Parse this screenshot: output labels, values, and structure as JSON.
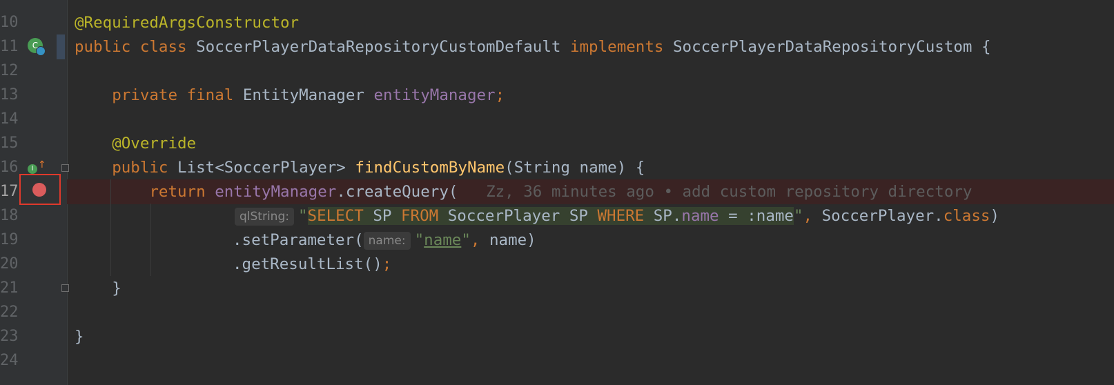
{
  "editor": {
    "lines": [
      {
        "num": "10"
      },
      {
        "num": "11"
      },
      {
        "num": "12"
      },
      {
        "num": "13"
      },
      {
        "num": "14"
      },
      {
        "num": "15"
      },
      {
        "num": "16"
      },
      {
        "num": "17"
      },
      {
        "num": "18"
      },
      {
        "num": "19"
      },
      {
        "num": "20"
      },
      {
        "num": "21"
      },
      {
        "num": "22"
      },
      {
        "num": "23"
      },
      {
        "num": "24"
      }
    ],
    "tokens": {
      "l10_ann": "@RequiredArgsConstructor",
      "l11_public": "public",
      "l11_class": "class",
      "l11_name": "SoccerPlayerDataRepositoryCustomDefault",
      "l11_implements": "implements",
      "l11_iface": "SoccerPlayerDataRepositoryCustom {",
      "l13_private": "private",
      "l13_final": "final",
      "l13_type": "EntityManager",
      "l13_field": "entityManager",
      "l13_semi": ";",
      "l15_ann": "@Override",
      "l16_public": "public",
      "l16_type": "List<SoccerPlayer>",
      "l16_method": "findCustomByName",
      "l16_params": "(String name) {",
      "l17_return": "return",
      "l17_field": "entityManager",
      "l17_call": ".createQuery(",
      "l17_blame": "Zz, 36 minutes ago • add custom repository directory",
      "l18_hint": "qlString:",
      "l18_quote_open": "\"",
      "l18_select": "SELECT",
      "l18_sp1": "SP",
      "l18_from": "FROM",
      "l18_entity": "SoccerPlayer SP",
      "l18_where": "WHERE",
      "l18_spdot": "SP.",
      "l18_namefield": "name",
      "l18_eq": "= :name",
      "l18_quote_close": "\"",
      "l18_comma": ",",
      "l18_classref": "SoccerPlayer.",
      "l18_classkw": "class",
      "l18_close": ")",
      "l19_call": ".setParameter(",
      "l19_hint": "name:",
      "l19_q1": "\"",
      "l19_str": "name",
      "l19_q2": "\"",
      "l19_rest_comma": ",",
      "l19_rest": "name)",
      "l20_call": ".getResultList()",
      "l20_semi": ";",
      "l21_brace": "}",
      "l23_brace": "}"
    }
  },
  "colors": {
    "background": "#2b2b2b",
    "keyword": "#cc7832",
    "annotation": "#bbb529",
    "field": "#9876aa",
    "method": "#ffc66d",
    "string": "#6a8759",
    "breakpoint": "#db5c5c",
    "highlight_box": "#e0392b"
  },
  "icons": {
    "implementation": "implemented-interface-icon",
    "override": "override-method-icon",
    "breakpoint": "breakpoint-icon"
  }
}
